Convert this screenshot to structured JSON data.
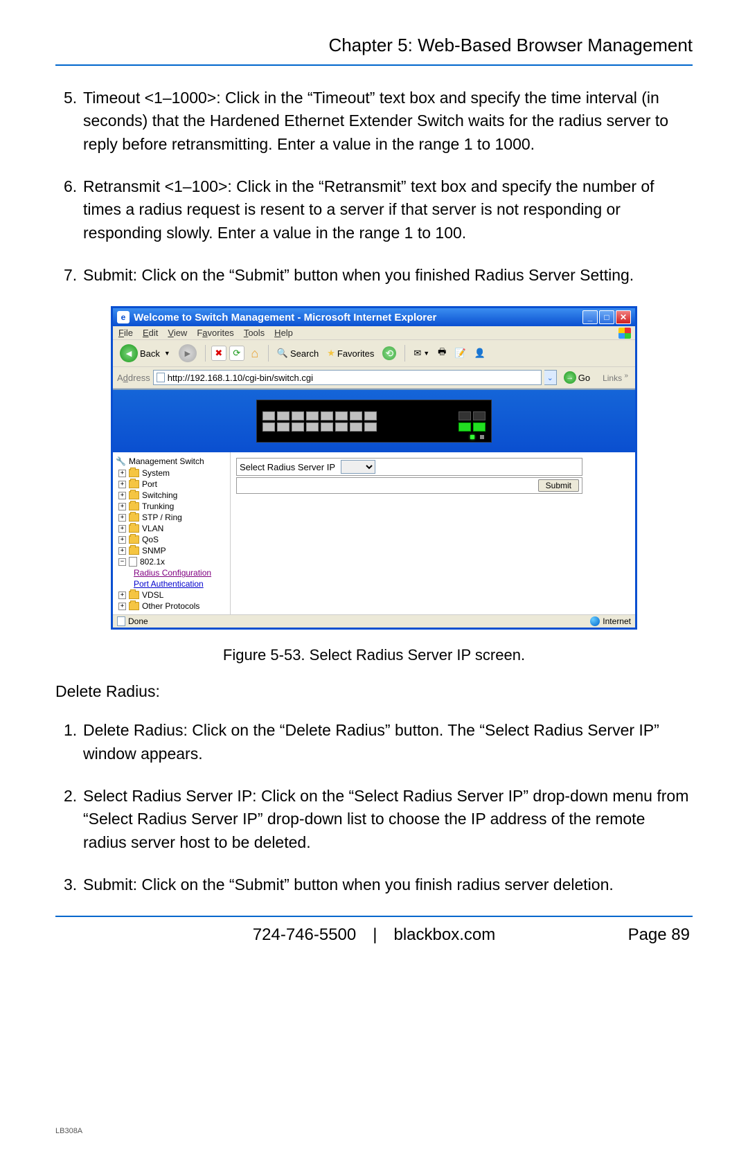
{
  "chapter_title": "Chapter 5: Web-Based Browser Management",
  "items_top": [
    {
      "n": "5.",
      "t": "Timeout <1–1000>: Click in the “Timeout” text box and specify the time interval (in seconds) that the Hardened Ethernet Extender Switch waits for the radius server to reply before retransmitting. Enter a value in the range 1 to 1000."
    },
    {
      "n": "6.",
      "t": "Retransmit <1–100>: Click in the “Retransmit” text box and specify the number of times a radius request is resent to a server if that server is not responding or responding slowly. Enter a value in the range 1 to 100."
    },
    {
      "n": "7.",
      "t": "Submit: Click on the “Submit” button when you finished Radius Server Setting."
    }
  ],
  "browser": {
    "title": "Welcome to Switch Management - Microsoft Internet Explorer",
    "menus": [
      "File",
      "Edit",
      "View",
      "Favorites",
      "Tools",
      "Help"
    ],
    "back": "Back",
    "search": "Search",
    "favorites": "Favorites",
    "address_label": "Address",
    "url": "http://192.168.1.10/cgi-bin/switch.cgi",
    "go": "Go",
    "links": "Links",
    "tree_root": "Management Switch",
    "tree": [
      "System",
      "Port",
      "Switching",
      "Trunking",
      "STP / Ring",
      "VLAN",
      "QoS",
      "SNMP"
    ],
    "tree_open": "802.1x",
    "tree_sub": [
      "Radius Configuration",
      "Port Authentication"
    ],
    "tree_after": [
      "VDSL",
      "Other Protocols"
    ],
    "form_label": "Select Radius Server IP",
    "submit": "Submit",
    "status_done": "Done",
    "status_zone": "Internet"
  },
  "caption": "Figure 5-53. Select Radius Server IP screen.",
  "subhead": "Delete Radius:",
  "items_bottom": [
    {
      "n": "1.",
      "t": "Delete Radius: Click on the “Delete Radius” button. The “Select Radius Server IP” window appears."
    },
    {
      "n": "2.",
      "t": "Select Radius Server IP: Click on the “Select Radius Server IP” drop-down menu from “Select Radius Server IP” drop-down list to choose the IP address of the remote radius server host to be deleted."
    },
    {
      "n": "3.",
      "t": "Submit: Click on the “Submit” button when you finish radius server deletion."
    }
  ],
  "footer_center": "724-746-5500 | blackbox.com",
  "footer_page": "Page 89",
  "model": "LB308A"
}
